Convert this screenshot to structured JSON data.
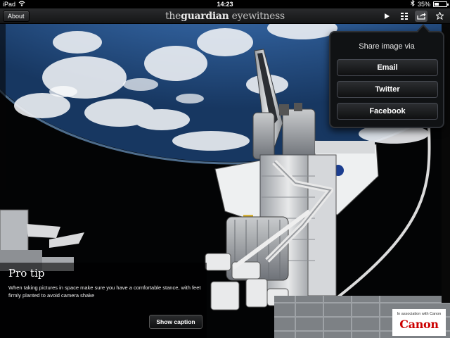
{
  "status_bar": {
    "device": "iPad",
    "time": "14:23",
    "battery_text": "35%",
    "battery_level": 0.35
  },
  "toolbar": {
    "about_label": "About",
    "logo_prefix": "the",
    "logo_brand": "guardian",
    "logo_suffix": " eyewitness",
    "play_icon": "play-icon",
    "grid_icon": "grid-icon",
    "share_icon": "share-icon",
    "star_icon": "star-icon"
  },
  "share_popover": {
    "title": "Share image via",
    "options": [
      "Email",
      "Twitter",
      "Facebook"
    ]
  },
  "caption": {
    "title": "Pro tip",
    "text": "When taking pictures in space make sure you have a comfortable stance, with feet firmly planted to avoid camera shake",
    "show_caption_label": "Show caption"
  },
  "sponsor": {
    "association_text": "In association with Canon",
    "logo_text": "Canon",
    "logo_color": "#cc0000"
  }
}
